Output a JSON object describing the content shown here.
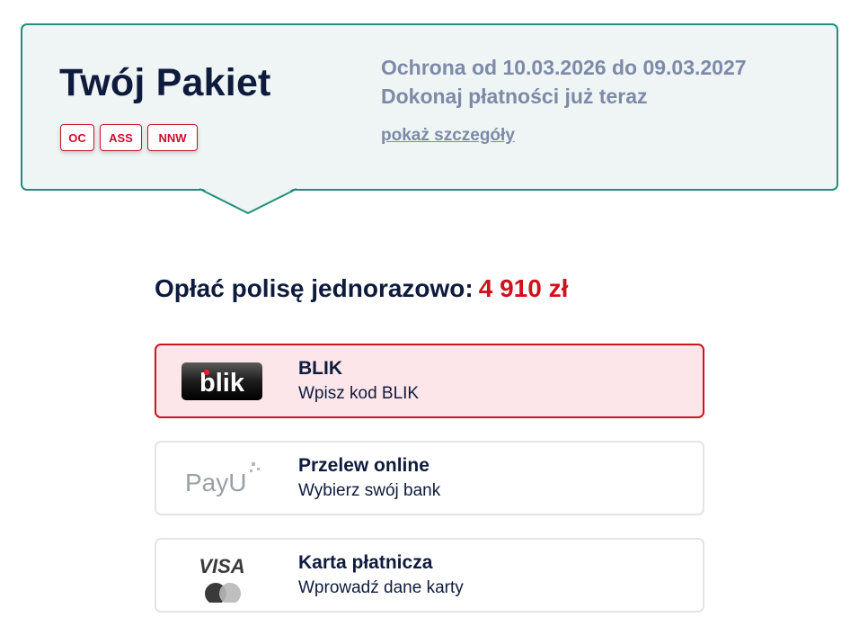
{
  "package": {
    "title": "Twój Pakiet",
    "badges": [
      "OC",
      "ASS",
      "NNW"
    ],
    "protection_text": "Ochrona od 10.03.2026 do 09.03.2027",
    "pay_now_text": "Dokonaj płatności już teraz",
    "details_link": "pokaż szczegóły"
  },
  "payment": {
    "heading": "Opłać polisę jednorazowo:",
    "amount": "4 910 zł",
    "methods": [
      {
        "title": "BLIK",
        "subtitle": "Wpisz kod BLIK",
        "logo_text": "blik",
        "selected": true
      },
      {
        "title": "Przelew online",
        "subtitle": "Wybierz swój bank",
        "logo_text": "PayU",
        "selected": false
      },
      {
        "title": "Karta płatnicza",
        "subtitle": "Wprowadź dane karty",
        "logo_text": "VISA",
        "selected": false
      }
    ]
  },
  "colors": {
    "accent_green": "#1d8f7c",
    "brand_red": "#d0121e",
    "navy_text": "#0f1b3d",
    "muted_text": "#7d8aa8"
  }
}
